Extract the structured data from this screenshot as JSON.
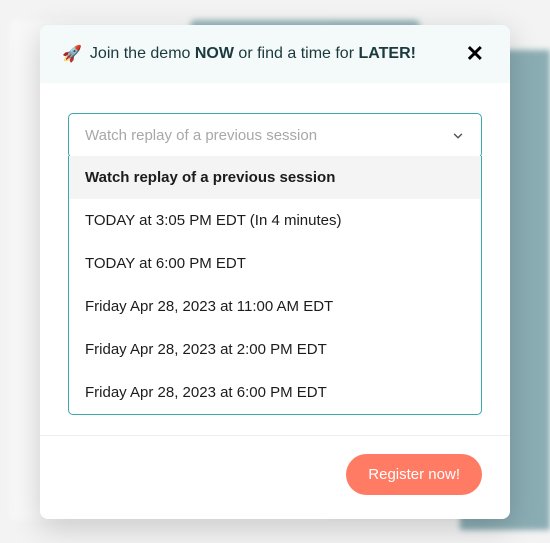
{
  "modal": {
    "icon": "🚀",
    "heading_prefix": "Join the demo ",
    "heading_bold1": "NOW",
    "heading_mid": " or find a time for ",
    "heading_bold2": "LATER!",
    "close_label": "✕"
  },
  "select": {
    "placeholder": "Watch replay of a previous session",
    "options": [
      "Watch replay of a previous session",
      "TODAY at 3:05 PM EDT (In 4 minutes)",
      "TODAY at 6:00 PM EDT",
      "Friday Apr 28, 2023 at 11:00 AM EDT",
      "Friday Apr 28, 2023 at 2:00 PM EDT",
      "Friday Apr 28, 2023 at 6:00 PM EDT"
    ]
  },
  "footer": {
    "register_label": "Register now!"
  }
}
